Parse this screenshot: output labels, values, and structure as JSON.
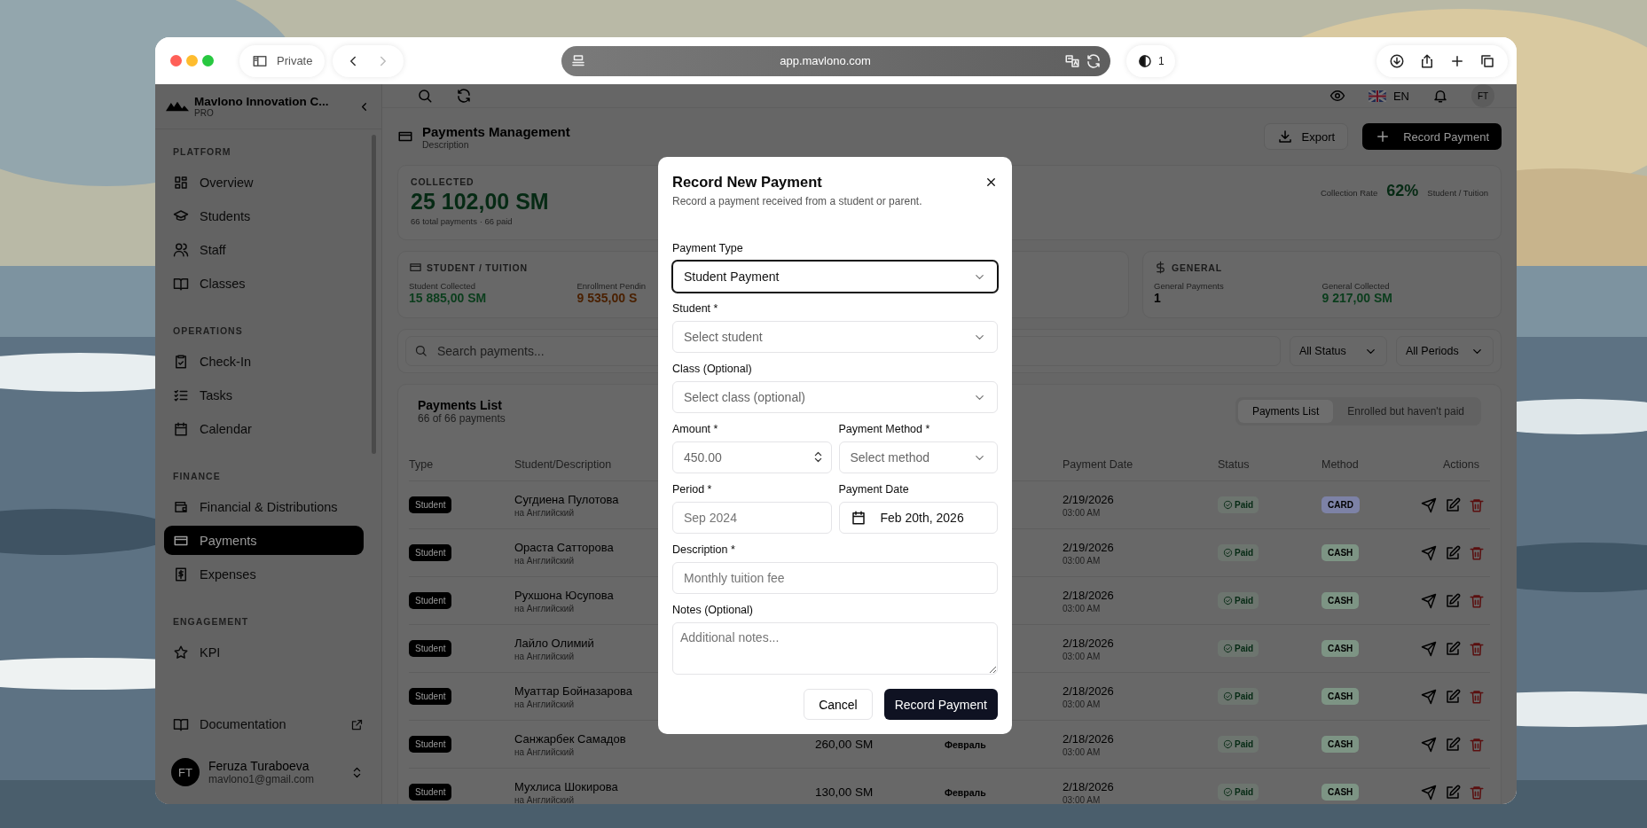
{
  "browser": {
    "private_label": "Private",
    "url": "app.mavlono.com",
    "tab_count": "1"
  },
  "sidebar": {
    "brand": "Mavlono Innovation C...",
    "plan": "PRO",
    "sections": [
      {
        "title": "PLATFORM",
        "items": [
          {
            "label": "Overview",
            "selected": false
          },
          {
            "label": "Students",
            "selected": false
          },
          {
            "label": "Staff",
            "selected": false
          },
          {
            "label": "Classes",
            "selected": false
          }
        ]
      },
      {
        "title": "OPERATIONS",
        "items": [
          {
            "label": "Check-In",
            "selected": false
          },
          {
            "label": "Tasks",
            "selected": false
          },
          {
            "label": "Calendar",
            "selected": false
          }
        ]
      },
      {
        "title": "FINANCE",
        "items": [
          {
            "label": "Financial & Distributions",
            "selected": false
          },
          {
            "label": "Payments",
            "selected": true
          },
          {
            "label": "Expenses",
            "selected": false
          }
        ]
      },
      {
        "title": "ENGAGEMENT",
        "items": [
          {
            "label": "KPI",
            "selected": false
          }
        ]
      }
    ],
    "footer_link": "Documentation",
    "user": {
      "initials": "FT",
      "name": "Feruza Turaboeva",
      "email": "mavlono1@gmail.com"
    }
  },
  "topbar": {
    "language": "EN",
    "avatar": "FT"
  },
  "page": {
    "title": "Payments Management",
    "subtitle": "Description",
    "export": "Export",
    "record": "Record Payment"
  },
  "summary": {
    "label": "COLLECTED",
    "amount": "25 102,00 SM",
    "note": "66 total payments · 66 paid",
    "rate_label": "Collection Rate",
    "rate": "62%",
    "rate_note": "Student / Tuition"
  },
  "stat_cards": [
    {
      "title": "STUDENT / TUITION",
      "stats": [
        {
          "label": "Student Collected",
          "value": "15 885,00 SM",
          "color": "#0a3d1c"
        },
        {
          "label": "Enrollment Pendin",
          "value": "9 535,00 S",
          "color": "#4a2000"
        }
      ]
    },
    {
      "title": "GENERAL",
      "stats": [
        {
          "label": "General Payments",
          "value": "1",
          "color": "#000000"
        },
        {
          "label": "General Collected",
          "value": "9 217,00 SM",
          "color": "#0a3d1c"
        }
      ]
    }
  ],
  "filters": {
    "search_placeholder": "Search payments...",
    "status": "All Status",
    "period": "All Periods"
  },
  "list": {
    "title": "Payments List",
    "count": "66 of 66 payments",
    "tabs": [
      {
        "label": "Payments List",
        "selected": true
      },
      {
        "label": "Enrolled but haven't paid",
        "selected": false
      }
    ],
    "columns": [
      "Type",
      "Student/Description",
      "Payment Date",
      "Status",
      "Method",
      "Actions"
    ],
    "rows": [
      {
        "type": "Student",
        "name": "Сугдиена Пулотова",
        "course": "на Английский",
        "date": "2/19/2026",
        "time": "03:00 AM",
        "status": "Paid",
        "method": "CARD",
        "color": "#7d82a6"
      },
      {
        "type": "Student",
        "name": "Ораста Сатторова",
        "course": "на Английский",
        "date": "2/19/2026",
        "time": "03:00 AM",
        "status": "Paid",
        "method": "CASH",
        "color": "#7d9484"
      },
      {
        "type": "Student",
        "name": "Рухшона Юсупова",
        "course": "на Английский",
        "date": "2/18/2026",
        "time": "03:00 AM",
        "status": "Paid",
        "method": "CASH",
        "color": "#7d9484"
      },
      {
        "type": "Student",
        "name": "Лайло Олимий",
        "course": "на Английский",
        "date": "2/18/2026",
        "time": "03:00 AM",
        "status": "Paid",
        "method": "CASH",
        "color": "#7d9484"
      },
      {
        "type": "Student",
        "name": "Муаттар Бойназарова",
        "course": "на Английский",
        "date": "2/18/2026",
        "time": "03:00 AM",
        "status": "Paid",
        "method": "CASH",
        "color": "#7d9484"
      },
      {
        "type": "Student",
        "name": "Санжарбек Самадов",
        "course": "на Английский",
        "amount": "260,00 SM",
        "period": "Февраль",
        "date": "2/18/2026",
        "time": "03:00 AM",
        "status": "Paid",
        "method": "CASH",
        "color": "#7d9484"
      },
      {
        "type": "Student",
        "name": "Мухлиса Шокирова",
        "course": "на Английский",
        "amount": "130,00 SM",
        "period": "Февраль",
        "date": "2/18/2026",
        "time": "03:00 AM",
        "status": "Paid",
        "method": "CASH",
        "color": "#7d9484"
      }
    ]
  },
  "modal": {
    "title": "Record New Payment",
    "subtitle": "Record a payment received from a student or parent.",
    "rows": [
      {
        "fields": [
          {
            "label": "Payment Type",
            "kind": "select",
            "value": "Student Payment",
            "focused": true
          }
        ]
      },
      {
        "fields": [
          {
            "label": "Student *",
            "kind": "select",
            "placeholder": "Select student",
            "focused": false
          }
        ]
      },
      {
        "fields": [
          {
            "label": "Class (Optional)",
            "kind": "select",
            "placeholder": "Select class (optional)",
            "focused": false
          }
        ]
      },
      {
        "fields": [
          {
            "label": "Amount *",
            "kind": "number",
            "placeholder": "450.00",
            "focused": false
          },
          {
            "label": "Payment Method *",
            "kind": "select",
            "placeholder": "Select method",
            "focused": false
          }
        ]
      },
      {
        "fields": [
          {
            "label": "Period *",
            "kind": "text",
            "placeholder": "Sep 2024",
            "focused": false
          },
          {
            "label": "Payment Date",
            "kind": "date",
            "value": "Feb 20th, 2026",
            "focused": false
          }
        ]
      },
      {
        "fields": [
          {
            "label": "Description *",
            "kind": "text",
            "placeholder": "Monthly tuition fee",
            "focused": false
          }
        ]
      },
      {
        "fields": [
          {
            "label": "Notes (Optional)",
            "kind": "textarea",
            "placeholder": "Additional notes...",
            "focused": false
          }
        ]
      }
    ],
    "cancel": "Cancel",
    "submit": "Record Payment"
  }
}
